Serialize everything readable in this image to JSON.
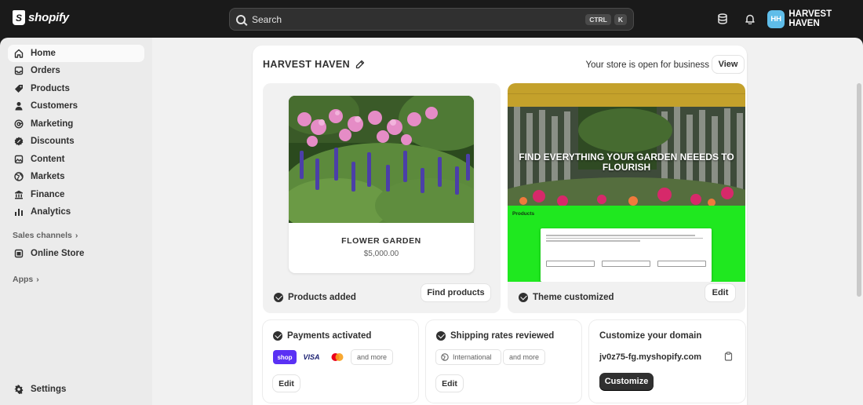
{
  "topbar": {
    "logo_text": "shopify",
    "search_placeholder": "Search",
    "shortcut_ctrl": "CTRL",
    "shortcut_key": "K",
    "avatar_initials": "HH",
    "store_name": "HARVEST HAVEN"
  },
  "sidebar": {
    "items": [
      {
        "label": "Home",
        "icon": "home-icon"
      },
      {
        "label": "Orders",
        "icon": "inbox-icon"
      },
      {
        "label": "Products",
        "icon": "tag-icon"
      },
      {
        "label": "Customers",
        "icon": "person-icon"
      },
      {
        "label": "Marketing",
        "icon": "target-icon"
      },
      {
        "label": "Discounts",
        "icon": "discount-icon"
      },
      {
        "label": "Content",
        "icon": "content-icon"
      },
      {
        "label": "Markets",
        "icon": "globe-icon"
      },
      {
        "label": "Finance",
        "icon": "bank-icon"
      },
      {
        "label": "Analytics",
        "icon": "bar-chart-icon"
      }
    ],
    "sales_channels_label": "Sales channels",
    "online_store_label": "Online Store",
    "apps_label": "Apps",
    "settings_label": "Settings"
  },
  "main": {
    "store_title": "HARVEST HAVEN",
    "open_text": "Your store is open for business",
    "view_label": "View",
    "products_tile": {
      "product_name": "FLOWER GARDEN",
      "product_price": "$5,000.00",
      "status_label": "Products added",
      "button_label": "Find products"
    },
    "theme_tile": {
      "hero_text": "FIND EVERYTHING YOUR GARDEN NEEEDS TO FLOURISH",
      "products_label": "Products",
      "status_label": "Theme customized",
      "button_label": "Edit"
    },
    "payments_tile": {
      "status_label": "Payments activated",
      "chips": [
        "shop",
        "VISA",
        "and more"
      ],
      "button_label": "Edit"
    },
    "shipping_tile": {
      "status_label": "Shipping rates reviewed",
      "chips": [
        "International",
        "and more"
      ],
      "button_label": "Edit"
    },
    "domain_tile": {
      "title": "Customize your domain",
      "domain": "jv0z75-fg.myshopify.com",
      "button_label": "Customize"
    }
  }
}
